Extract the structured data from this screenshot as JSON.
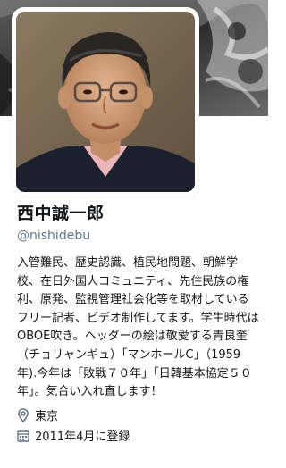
{
  "profile": {
    "display_name": "西中誠一郎",
    "screen_name": "@nishidebu",
    "bio": "入管難民、歴史認識、植民地問題、朝鮮学校、在日外国人コミュニティ、先住民族の権利、原発、監視管理社会化等を取材しているフリー記者、ビデオ制作してます。学生時代はOBOE吹き。ヘッダーの絵は敬愛する青良奎（チョリャンギュ）「マンホールC」（1959年).今年は「敗戦７０年」「日韓基本協定５０年」。気合い入れ直します！",
    "location": "東京",
    "joined": "2011年4月に登録"
  },
  "icons": {
    "location": "map-pin-icon",
    "joined": "calendar-icon"
  },
  "colors": {
    "text": "#14171a",
    "secondary": "#657786"
  }
}
